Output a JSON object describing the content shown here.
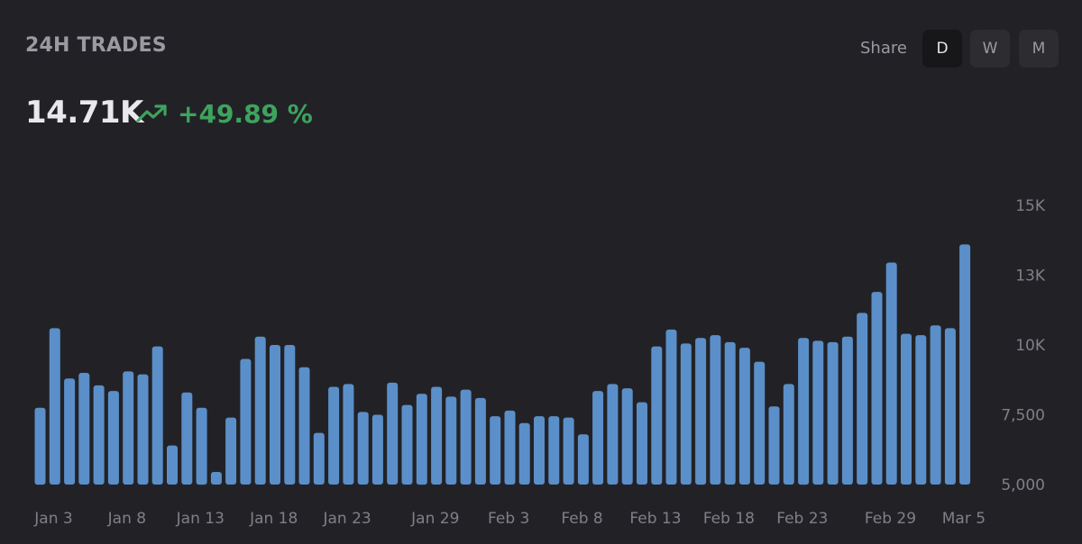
{
  "header": {
    "title": "24H TRADES",
    "share_label": "Share",
    "ranges": [
      "D",
      "W",
      "M"
    ],
    "active_range": "D",
    "value": "14.71K",
    "change": "+49.89 %",
    "trend_icon": "trending-up-icon"
  },
  "colors": {
    "background": "#222226",
    "bar": "#5b8fc9",
    "positive": "#3ea35e"
  },
  "chart_data": {
    "type": "bar",
    "xlabel": "",
    "ylabel": "",
    "ylim": [
      5000,
      15000
    ],
    "y_ticks": [
      "15K",
      "13K",
      "10K",
      "7,500",
      "5,000"
    ],
    "y_tick_values": [
      15000,
      12500,
      10000,
      7500,
      5000
    ],
    "x_tick_labels": [
      "Jan 3",
      "Jan 8",
      "Jan 13",
      "Jan 18",
      "Jan 23",
      "Jan 29",
      "Feb 3",
      "Feb 8",
      "Feb 13",
      "Feb 18",
      "Feb 23",
      "Feb 29",
      "Mar 5"
    ],
    "x_tick_indices": [
      0,
      5,
      10,
      15,
      20,
      26,
      31,
      36,
      41,
      46,
      51,
      57,
      62
    ],
    "categories": [
      "Jan 3",
      "Jan 4",
      "Jan 5",
      "Jan 6",
      "Jan 7",
      "Jan 8",
      "Jan 9",
      "Jan 10",
      "Jan 11",
      "Jan 12",
      "Jan 13",
      "Jan 14",
      "Jan 15",
      "Jan 16",
      "Jan 17",
      "Jan 18",
      "Jan 19",
      "Jan 20",
      "Jan 21",
      "Jan 22",
      "Jan 23",
      "Jan 24",
      "Jan 25",
      "Jan 26",
      "Jan 27",
      "Jan 28",
      "Jan 29",
      "Jan 30",
      "Jan 31",
      "Feb 1",
      "Feb 2",
      "Feb 3",
      "Feb 4",
      "Feb 5",
      "Feb 6",
      "Feb 7",
      "Feb 8",
      "Feb 9",
      "Feb 10",
      "Feb 11",
      "Feb 12",
      "Feb 13",
      "Feb 14",
      "Feb 15",
      "Feb 16",
      "Feb 17",
      "Feb 18",
      "Feb 19",
      "Feb 20",
      "Feb 21",
      "Feb 22",
      "Feb 23",
      "Feb 24",
      "Feb 25",
      "Feb 26",
      "Feb 27",
      "Feb 28",
      "Feb 29",
      "Mar 1",
      "Mar 2",
      "Mar 3",
      "Mar 4",
      "Mar 5"
    ],
    "values": [
      7750,
      10600,
      8800,
      9000,
      8550,
      8350,
      9050,
      8950,
      9950,
      6400,
      8300,
      7750,
      5450,
      7400,
      9500,
      10300,
      10000,
      10000,
      9200,
      6850,
      8500,
      8600,
      7600,
      7500,
      8650,
      7850,
      8250,
      8500,
      8150,
      8400,
      8100,
      7450,
      7650,
      7200,
      7450,
      7450,
      7400,
      6800,
      8350,
      8600,
      8450,
      7950,
      9950,
      10550,
      10050,
      10250,
      10350,
      10100,
      9900,
      9400,
      7800,
      8600,
      10250,
      10150,
      10100,
      10300,
      11150,
      11900,
      12950,
      10400,
      10350,
      10700,
      10600,
      13600
    ]
  }
}
